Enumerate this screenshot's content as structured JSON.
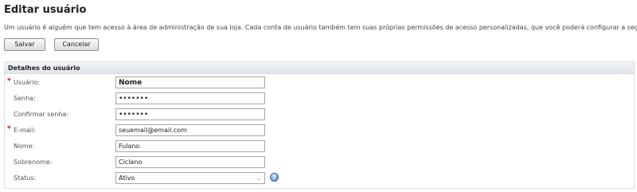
{
  "page": {
    "title": "Editar usuário",
    "description": "Um usuário é alguém que tem acesso à área de administração de sua loja. Cada conta de usuário também tem suas próprias permissões de acesso personalizadas, que você poderá configurar a seguir."
  },
  "actions": {
    "save_label": "Salvar",
    "cancel_label": "Cancelar"
  },
  "panel": {
    "title": "Detalhes do usuário",
    "required_mark": "*",
    "fields": {
      "username": {
        "label": "Usuário:",
        "value": "Nome",
        "required": true
      },
      "password": {
        "label": "Senha:",
        "value": "•••••••"
      },
      "confirm_password": {
        "label": "Confirmar senha:",
        "value": "•••••••"
      },
      "email": {
        "label": "E-mail:",
        "value": "seuemail@email.com",
        "required": true
      },
      "first_name": {
        "label": "Nome:",
        "value": "Fulano"
      },
      "last_name": {
        "label": "Sobrenome:",
        "value": "Ciclano"
      },
      "status": {
        "label": "Status:",
        "value": "Ativo"
      }
    },
    "help_glyph": "?",
    "dropdown_glyph": "⌄"
  },
  "colors": {
    "required": "#cc0000",
    "panel_header": "#e1e5ea",
    "help_icon": "#4f84c4"
  }
}
